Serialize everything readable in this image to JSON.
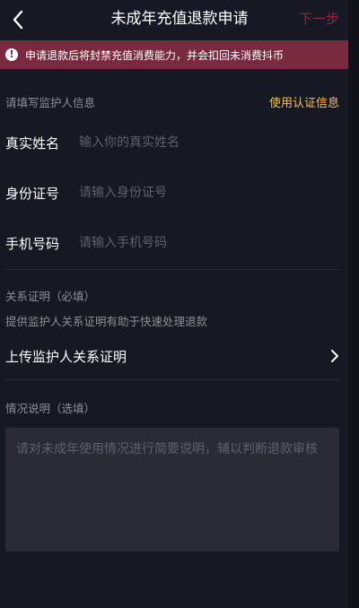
{
  "nav": {
    "title": "未成年充值退款申请",
    "next_label": "下一步"
  },
  "banner": {
    "icon": "exclamation-circle-icon",
    "text": "申请退款后将封禁充值消费能力，并会扣回未消费抖币"
  },
  "guardian_section": {
    "hint": "请填写监护人信息",
    "use_cert_label": "使用认证信息",
    "fields": [
      {
        "label": "真实姓名",
        "placeholder": "输入你的真实姓名",
        "value": ""
      },
      {
        "label": "身份证号",
        "placeholder": "请输入身份证号",
        "value": ""
      },
      {
        "label": "手机号码",
        "placeholder": "请输入手机号码",
        "value": ""
      }
    ]
  },
  "relation_section": {
    "title": "关系证明（必填）",
    "description": "提供监护人关系证明有助于快速处理退款",
    "upload_label": "上传监护人关系证明"
  },
  "situation_section": {
    "title": "情况说明（选填）",
    "placeholder": "请对未成年使用情况进行简要说明，辅以判断退款审核",
    "value": ""
  },
  "colors": {
    "background": "#161823",
    "banner": "#7a2a3e",
    "accent_yellow": "#f5c541",
    "next_disabled": "#8a2d3e",
    "placeholder": "#5f606b"
  }
}
